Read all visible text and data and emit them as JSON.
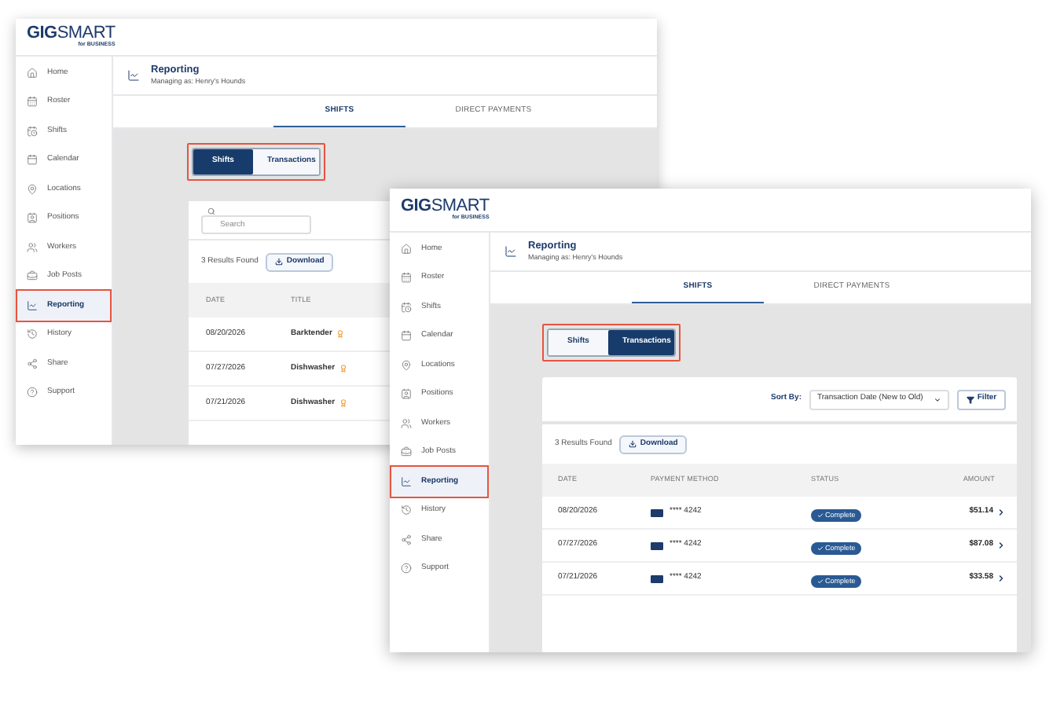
{
  "windows": [
    {
      "logo": {
        "bold": "GIG",
        "light": "SMART",
        "tagline": "for BUSINESS"
      },
      "sidebar": [
        {
          "label": "Home",
          "selected": false,
          "highlighted": false
        },
        {
          "label": "Roster",
          "selected": false,
          "highlighted": false
        },
        {
          "label": "Shifts",
          "selected": false,
          "highlighted": false
        },
        {
          "label": "Calendar",
          "selected": false,
          "highlighted": false
        },
        {
          "label": "Locations",
          "selected": false,
          "highlighted": false
        },
        {
          "label": "Positions",
          "selected": false,
          "highlighted": false
        },
        {
          "label": "Workers",
          "selected": false,
          "highlighted": false
        },
        {
          "label": "Job Posts",
          "selected": false,
          "highlighted": false
        },
        {
          "label": "Reporting",
          "selected": true,
          "highlighted": true
        },
        {
          "label": "History",
          "selected": false,
          "highlighted": false
        },
        {
          "label": "Share",
          "selected": false,
          "highlighted": false
        },
        {
          "label": "Support",
          "selected": false,
          "highlighted": false
        }
      ],
      "header": {
        "title": "Reporting",
        "subtitle": "Managing as: Henry's Hounds"
      },
      "tabs": [
        {
          "label": "SHIFTS",
          "selected": true
        },
        {
          "label": "DIRECT PAYMENTS",
          "selected": false
        }
      ],
      "toggle": {
        "highlighted": true,
        "options": [
          {
            "label": "Shifts",
            "selected": true
          },
          {
            "label": "Transactions",
            "selected": false
          }
        ]
      },
      "search": {
        "placeholder": "Search"
      },
      "results": "3 Results Found",
      "download": "Download",
      "columns": [
        "DATE",
        "TITLE"
      ],
      "rows": [
        {
          "date": "08/20/2026",
          "title": "Barktender"
        },
        {
          "date": "07/27/2026",
          "title": "Dishwasher"
        },
        {
          "date": "07/21/2026",
          "title": "Dishwasher"
        }
      ]
    },
    {
      "logo": {
        "bold": "GIG",
        "light": "SMART",
        "tagline": "for BUSINESS"
      },
      "sidebar": [
        {
          "label": "Home",
          "selected": false,
          "highlighted": false
        },
        {
          "label": "Roster",
          "selected": false,
          "highlighted": false
        },
        {
          "label": "Shifts",
          "selected": false,
          "highlighted": false
        },
        {
          "label": "Calendar",
          "selected": false,
          "highlighted": false
        },
        {
          "label": "Locations",
          "selected": false,
          "highlighted": false
        },
        {
          "label": "Positions",
          "selected": false,
          "highlighted": false
        },
        {
          "label": "Workers",
          "selected": false,
          "highlighted": false
        },
        {
          "label": "Job Posts",
          "selected": false,
          "highlighted": false
        },
        {
          "label": "Reporting",
          "selected": true,
          "highlighted": true
        },
        {
          "label": "History",
          "selected": false,
          "highlighted": false
        },
        {
          "label": "Share",
          "selected": false,
          "highlighted": false
        },
        {
          "label": "Support",
          "selected": false,
          "highlighted": false
        }
      ],
      "header": {
        "title": "Reporting",
        "subtitle": "Managing as: Henry's Hounds"
      },
      "tabs": [
        {
          "label": "SHIFTS",
          "selected": true
        },
        {
          "label": "DIRECT PAYMENTS",
          "selected": false
        }
      ],
      "toggle": {
        "highlighted": true,
        "options": [
          {
            "label": "Shifts",
            "selected": false
          },
          {
            "label": "Transactions",
            "selected": true
          }
        ]
      },
      "sort": {
        "label": "Sort By:",
        "value": "Transaction Date (New to Old)"
      },
      "filter": "Filter",
      "results": "3 Results Found",
      "download": "Download",
      "columns": [
        "DATE",
        "PAYMENT METHOD",
        "STATUS",
        "AMOUNT"
      ],
      "rows": [
        {
          "date": "08/20/2026",
          "card": "**** 4242",
          "status": "Complete",
          "amount": "$51.14"
        },
        {
          "date": "07/27/2026",
          "card": "**** 4242",
          "status": "Complete",
          "amount": "$87.08"
        },
        {
          "date": "07/21/2026",
          "card": "**** 4242",
          "status": "Complete",
          "amount": "$33.58"
        }
      ]
    }
  ]
}
